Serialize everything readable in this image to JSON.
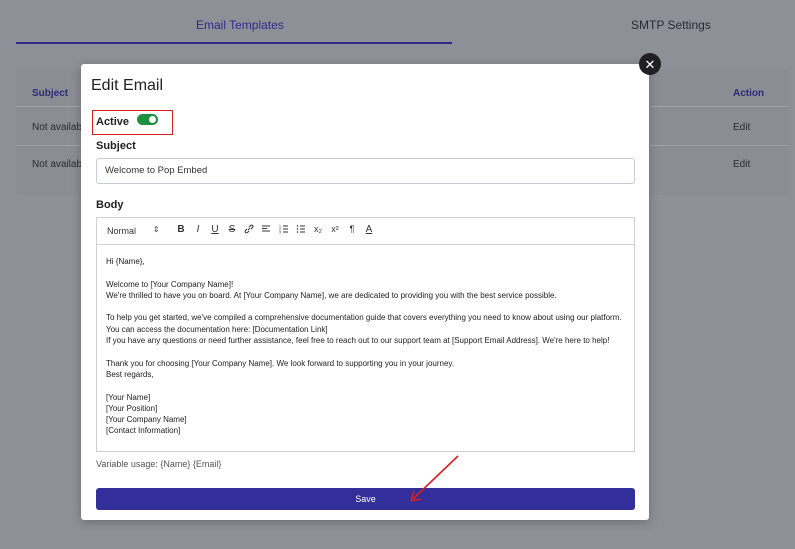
{
  "background": {
    "tabs": [
      {
        "label": "Email Templates",
        "active": true
      },
      {
        "label": "SMTP Settings",
        "active": false
      }
    ],
    "table": {
      "headers": {
        "subject": "Subject",
        "action": "Action"
      },
      "rows": [
        {
          "subject": "Not availab",
          "action": "Edit"
        },
        {
          "subject": "Not availab",
          "action": "Edit"
        }
      ]
    }
  },
  "modal": {
    "title": "Edit Email",
    "close_icon": "close-icon",
    "active_label": "Active",
    "active_on": true,
    "subject_label": "Subject",
    "subject_value": "Welcome to Pop Embed",
    "body_label": "Body",
    "toolbar": {
      "format_select": "Normal",
      "buttons": [
        "B",
        "I",
        "U",
        "S",
        "🔗",
        "≡",
        "⒈",
        "•",
        "x₂",
        "x²",
        "¶",
        "A"
      ]
    },
    "body_lines": [
      "Hi {Name},",
      "",
      "Welcome to [Your Company Name]!",
      "We're thrilled to have you on board. At [Your Company Name], we are dedicated to providing you with the best service possible.",
      "",
      "To help you get started, we've compiled a comprehensive documentation guide that covers everything you need to know about using our platform.",
      "You can access the documentation here: [Documentation Link]",
      "If you have any questions or need further assistance, feel free to reach out to our support team at [Support Email Address]. We're here to help!",
      "",
      "Thank you for choosing [Your Company Name]. We look forward to supporting you in your journey.",
      "Best regards,",
      "",
      "[Your Name]",
      "[Your Position]",
      "[Your Company Name]",
      "[Contact Information]"
    ],
    "variable_usage": "Variable usage: {Name} {Email}",
    "save_label": "Save"
  },
  "colors": {
    "accent": "#322e9a",
    "toggle_on": "#1e8f3e",
    "annotation": "#d42020"
  }
}
